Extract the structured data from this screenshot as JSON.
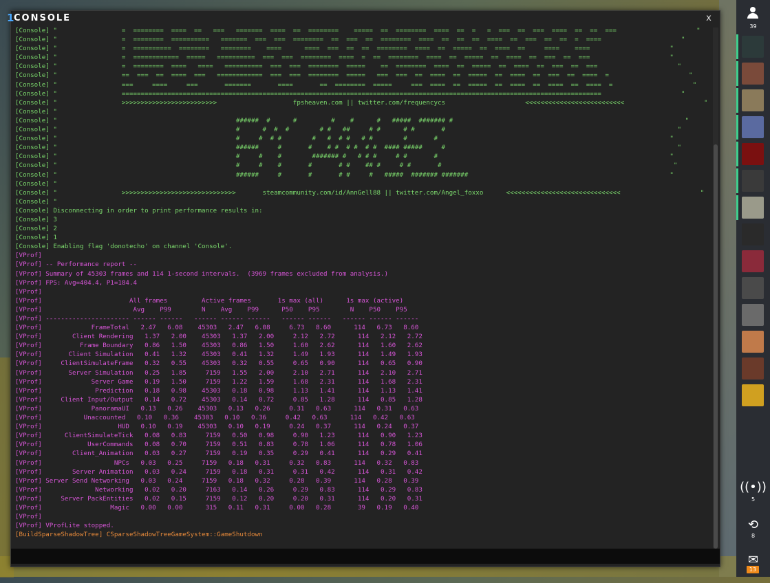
{
  "console": {
    "title": "CONSOLE",
    "close_label": "x",
    "lines": [
      {
        "cls": "",
        "text": "[Console] \"                 =  ========  ====  ==   ===   =======  ====  ==  ========    =====  ==  ========  ====  ==  =   =  ===  ==  ===  ====  ==  ==  ===                     \""
      },
      {
        "cls": "",
        "text": "[Console] \"                 =  ========  ==========   =======  ===  ===  ========  ==  ===  ==  ========  ====  ==  ==  ==  ====  ==  ===  ==  ==  =  ====                     \""
      },
      {
        "cls": "",
        "text": "[Console] \"                 =  ==========  ========   ========    ====      ====  ===  ==  ==  ========  ====  ==  =====  ==  ====  ==     ====    ====                     \""
      },
      {
        "cls": "",
        "text": "[Console] \"                 =  ============  =====   ==========  ===  ===  ========  ====  =  ==  ========  ====  ==  =====  ==  ====  ==  ===  ==  ===                     \""
      },
      {
        "cls": "",
        "text": "[Console] \"                 =  ========  ====   ====   ==========  ===  ===  ========  =====    ==  ========  ====  ==  =====  ==  ====  ==  ===  ==  ===                     \""
      },
      {
        "cls": "",
        "text": "[Console] \"                 ==  ===  ==  ====  ===   ============  ===  ===  ========  =====   ===  ===  ==  ====  ==  =====  ==  ====  ==  ===  ==  ====  =                     \""
      },
      {
        "cls": "",
        "text": "[Console] \"                 ===     ====     ===       =======       ====       ==  ========  =====     ===  ====  ==  =====  ==  ====  ==  ====  ==  ====  =                     \""
      },
      {
        "cls": "",
        "text": "[Console] \"                 ==============================================================================================================================                     \""
      },
      {
        "cls": "",
        "text": "[Console] \"                 >>>>>>>>>>>>>>>>>>>>>>>>>                    fpsheaven.com || twitter.com/frequencycs                     <<<<<<<<<<<<<<<<<<<<<<<<<<                     \""
      },
      {
        "cls": "",
        "text": "[Console] \""
      },
      {
        "cls": "",
        "text": "[Console] \"                                               ######  #      #         #    #      #   #####  ####### #                                                             \""
      },
      {
        "cls": "",
        "text": "[Console] \"                                               #      #  #  #        # #   ##     # #      # #       #                                                             \""
      },
      {
        "cls": "",
        "text": "[Console] \"                                               #     #  # #        #   #  # #   # #        #       #                                                             \""
      },
      {
        "cls": "",
        "text": "[Console] \"                                               ######     #       #    # #  # #  # #  #### #####     #                                                             \""
      },
      {
        "cls": "",
        "text": "[Console] \"                                               #     #    #        ####### #   # # #     # #       #                                                             \""
      },
      {
        "cls": "",
        "text": "[Console] \"                                               #     #    #       #       # #    ## #     # #       #                                                             \""
      },
      {
        "cls": "",
        "text": "[Console] \"                                               ######     #       #       # #     #   #####  ####### #######                                                     \""
      },
      {
        "cls": "",
        "text": "[Console] \""
      },
      {
        "cls": "",
        "text": "[Console] \"                 >>>>>>>>>>>>>>>>>>>>>>>>>>>>>>       steamcommunity.com/id/AnnGell88 || twitter.com/Angel_foxxo      <<<<<<<<<<<<<<<<<<<<<<<<<<<<<<                     \""
      },
      {
        "cls": "",
        "text": "[Console] \""
      },
      {
        "cls": "",
        "text": "[Console] Disconnecting in order to print performance results in:"
      },
      {
        "cls": "",
        "text": "[Console] 3"
      },
      {
        "cls": "",
        "text": "[Console] 2"
      },
      {
        "cls": "",
        "text": "[Console] 1"
      },
      {
        "cls": "",
        "text": "[Console] Enabling flag 'donotecho' on channel 'Console'."
      },
      {
        "cls": "vprof",
        "text": "[VProf]"
      },
      {
        "cls": "vprof",
        "text": "[VProf] -- Performance report --"
      },
      {
        "cls": "vprof",
        "text": "[VProf] Summary of 45303 frames and 114 1-second intervals.  (3969 frames excluded from analysis.)"
      },
      {
        "cls": "vprof",
        "text": "[VProf] FPS: Avg=404.4, P1=184.4"
      },
      {
        "cls": "vprof",
        "text": "[VProf]"
      },
      {
        "cls": "vprof",
        "text": "[VProf]                       All frames         Active frames       1s max (all)      1s max (active)"
      },
      {
        "cls": "vprof",
        "text": "[VProf]                        Avg    P99        N    Avg    P99      P50    P95        N    P50    P95"
      },
      {
        "cls": "vprof",
        "text": "[VProf] ---------------------- ------ ------   ------ ------ ------   ------ ------   ------ ------ ------"
      },
      {
        "cls": "vprof",
        "text": "[VProf]             FrameTotal   2.47   6.08    45303   2.47   6.08     6.73   8.60      114   6.73   8.60"
      },
      {
        "cls": "vprof",
        "text": "[VProf]        Client Rendering   1.37   2.00    45303   1.37   2.00     2.12   2.72      114   2.12   2.72"
      },
      {
        "cls": "vprof",
        "text": "[VProf]          Frame Boundary   0.86   1.50    45303   0.86   1.50     1.60   2.62      114   1.60   2.62"
      },
      {
        "cls": "vprof",
        "text": "[VProf]       Client Simulation   0.41   1.32    45303   0.41   1.32     1.49   1.93      114   1.49   1.93"
      },
      {
        "cls": "vprof",
        "text": "[VProf]     ClientSimulateFrame   0.32   0.55    45303   0.32   0.55     0.65   0.90      114   0.65   0.90"
      },
      {
        "cls": "vprof",
        "text": "[VProf]       Server Simulation   0.25   1.85     7159   1.55   2.00     2.10   2.71      114   2.10   2.71"
      },
      {
        "cls": "vprof",
        "text": "[VProf]             Server Game   0.19   1.50     7159   1.22   1.59     1.68   2.31      114   1.68   2.31"
      },
      {
        "cls": "vprof",
        "text": "[VProf]              Prediction   0.18   0.98    45303   0.18   0.98     1.13   1.41      114   1.13   1.41"
      },
      {
        "cls": "vprof",
        "text": "[VProf]     Client Input/Output   0.14   0.72    45303   0.14   0.72     0.85   1.28      114   0.85   1.28"
      },
      {
        "cls": "vprof",
        "text": "[VProf]             PanoramaUI   0.13   0.26    45303   0.13   0.26     0.31   0.63      114   0.31   0.63"
      },
      {
        "cls": "vprof",
        "text": "[VProf]           Unaccounted   0.10   0.36    45303   0.10   0.36     0.42   0.63      114   0.42   0.63"
      },
      {
        "cls": "vprof",
        "text": "[VProf]                    HUD   0.10   0.19    45303   0.10   0.19     0.24   0.37      114   0.24   0.37"
      },
      {
        "cls": "vprof",
        "text": "[VProf]      ClientSimulateTick   0.08   0.83     7159   0.50   0.98     0.90   1.23      114   0.90   1.23"
      },
      {
        "cls": "vprof",
        "text": "[VProf]            UserCommands   0.08   0.70     7159   0.51   0.83     0.78   1.06      114   0.78   1.06"
      },
      {
        "cls": "vprof",
        "text": "[VProf]        Client_Animation   0.03   0.27     7159   0.19   0.35     0.29   0.41      114   0.29   0.41"
      },
      {
        "cls": "vprof",
        "text": "[VProf]                   NPCs   0.03   0.25     7159   0.18   0.31     0.32   0.83      114   0.32   0.83"
      },
      {
        "cls": "vprof",
        "text": "[VProf]        Server Animation   0.03   0.24     7159   0.18   0.31     0.31   0.42      114   0.31   0.42"
      },
      {
        "cls": "vprof",
        "text": "[VProf] Server Send Networking   0.03   0.24     7159   0.18   0.32     0.28   0.39      114   0.28   0.39"
      },
      {
        "cls": "vprof",
        "text": "[VProf]              Networking   0.02   0.20     7163   0.14   0.26     0.29   0.83      114   0.29   0.83"
      },
      {
        "cls": "vprof",
        "text": "[VProf]     Server PackEntities   0.02   0.15     7159   0.12   0.20     0.20   0.31      114   0.20   0.31"
      },
      {
        "cls": "vprof",
        "text": "[VProf]                  Magic   0.00   0.00      315   0.11   0.31     0.00   0.28       39   0.19   0.40"
      },
      {
        "cls": "vprof",
        "text": "[VProf]"
      },
      {
        "cls": "vprof",
        "text": "[VProf] VProfLite stopped."
      },
      {
        "cls": "build",
        "text": "[BuildSparseShadowTree] CSparseShadowTreeGameSystem::GameShutdown"
      }
    ]
  },
  "sidebar": {
    "friends_count": "39",
    "avatars": [
      {
        "name": "avatar-1",
        "color": "#2c3a3a"
      },
      {
        "name": "avatar-2",
        "color": "#7a4a3a"
      },
      {
        "name": "avatar-3",
        "color": "#8a7a5a"
      },
      {
        "name": "avatar-4",
        "color": "#5a6aa0"
      },
      {
        "name": "avatar-5",
        "color": "#7a1010"
      },
      {
        "name": "avatar-6",
        "color": "#3a3a3a"
      },
      {
        "name": "avatar-7",
        "color": "#9a9a8a"
      },
      {
        "name": "avatar-8",
        "color": "#2a2a2a"
      },
      {
        "name": "avatar-9",
        "color": "#8a2a3a"
      },
      {
        "name": "avatar-10",
        "color": "#4a4a4a"
      },
      {
        "name": "avatar-11",
        "color": "#6a6a6a"
      },
      {
        "name": "avatar-12",
        "color": "#c07a4a"
      },
      {
        "name": "avatar-13",
        "color": "#6a3a2a"
      },
      {
        "name": "avatar-14",
        "color": "#d0a020"
      }
    ],
    "broadcast_count": "5",
    "history_count": "8",
    "mail_count": "13"
  },
  "colors": {
    "console_text": "#7bd86c",
    "vprof_text": "#d655d6",
    "build_text": "#e6893a",
    "online_indicator": "#3ecf8e",
    "mail_badge": "#f08a1a"
  }
}
